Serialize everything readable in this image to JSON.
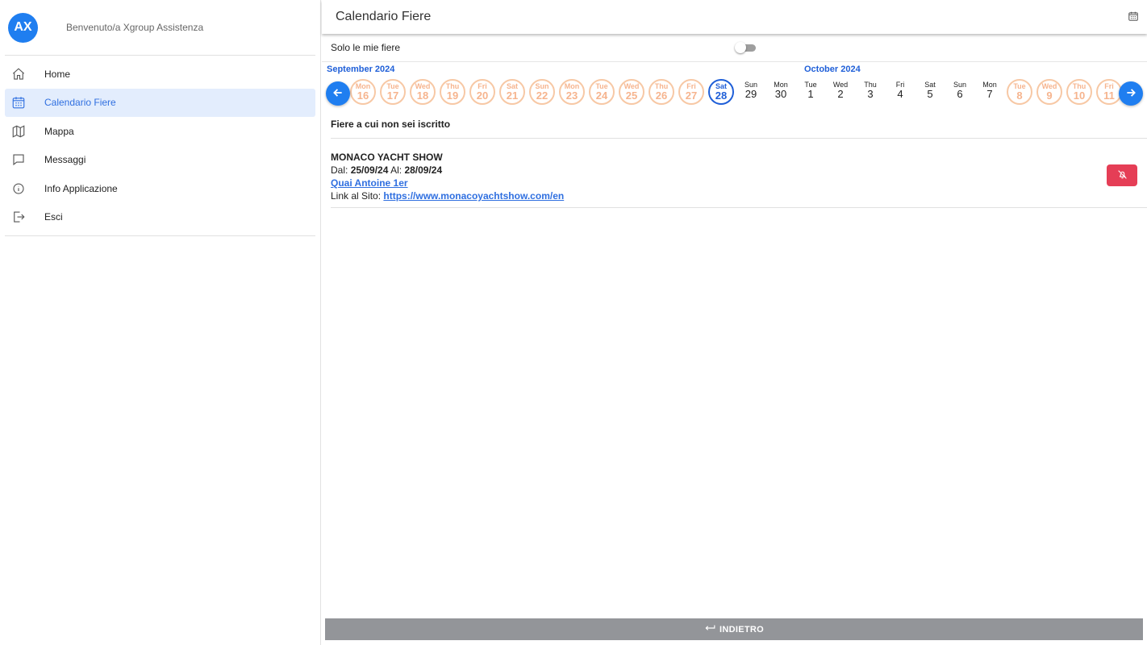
{
  "user": {
    "initials": "AX",
    "welcome": "Benvenuto/a Xgroup Assistenza"
  },
  "sidebar": {
    "items": [
      {
        "label": "Home",
        "icon": "home-icon",
        "active": false
      },
      {
        "label": "Calendario Fiere",
        "icon": "calendar-icon",
        "active": true
      },
      {
        "label": "Mappa",
        "icon": "map-icon",
        "active": false
      },
      {
        "label": "Messaggi",
        "icon": "message-icon",
        "active": false
      },
      {
        "label": "Info Applicazione",
        "icon": "info-icon",
        "active": false
      },
      {
        "label": "Esci",
        "icon": "logout-icon",
        "active": false
      }
    ]
  },
  "header": {
    "title": "Calendario Fiere",
    "icon": "calendar-icon"
  },
  "filter": {
    "label": "Solo le mie fiere",
    "toggle_on": false
  },
  "calendar": {
    "months": [
      "September 2024",
      "October 2024"
    ],
    "days": [
      {
        "name": "Mon",
        "num": "16",
        "state": "past"
      },
      {
        "name": "Tue",
        "num": "17",
        "state": "past"
      },
      {
        "name": "Wed",
        "num": "18",
        "state": "past"
      },
      {
        "name": "Thu",
        "num": "19",
        "state": "past"
      },
      {
        "name": "Fri",
        "num": "20",
        "state": "past"
      },
      {
        "name": "Sat",
        "num": "21",
        "state": "past"
      },
      {
        "name": "Sun",
        "num": "22",
        "state": "past"
      },
      {
        "name": "Mon",
        "num": "23",
        "state": "past"
      },
      {
        "name": "Tue",
        "num": "24",
        "state": "past"
      },
      {
        "name": "Wed",
        "num": "25",
        "state": "past"
      },
      {
        "name": "Thu",
        "num": "26",
        "state": "past"
      },
      {
        "name": "Fri",
        "num": "27",
        "state": "past"
      },
      {
        "name": "Sat",
        "num": "28",
        "state": "today"
      },
      {
        "name": "Sun",
        "num": "29",
        "state": "normal"
      },
      {
        "name": "Mon",
        "num": "30",
        "state": "normal"
      },
      {
        "name": "Tue",
        "num": "1",
        "state": "normal"
      },
      {
        "name": "Wed",
        "num": "2",
        "state": "normal"
      },
      {
        "name": "Thu",
        "num": "3",
        "state": "normal"
      },
      {
        "name": "Fri",
        "num": "4",
        "state": "normal"
      },
      {
        "name": "Sat",
        "num": "5",
        "state": "normal"
      },
      {
        "name": "Sun",
        "num": "6",
        "state": "normal"
      },
      {
        "name": "Mon",
        "num": "7",
        "state": "normal"
      },
      {
        "name": "Tue",
        "num": "8",
        "state": "future"
      },
      {
        "name": "Wed",
        "num": "9",
        "state": "future"
      },
      {
        "name": "Thu",
        "num": "10",
        "state": "future"
      },
      {
        "name": "Fri",
        "num": "11",
        "state": "future"
      }
    ]
  },
  "section": {
    "title": "Fiere a cui non sei iscritto"
  },
  "event": {
    "title": "MONACO YACHT SHOW",
    "from_label": "Dal:",
    "from_date": "25/09/24",
    "to_label": "Al:",
    "to_date": "28/09/24",
    "location": "Quai Antoine 1er",
    "site_label": "Link al Sito:",
    "site_url": "https://www.monacoyachtshow.com/en",
    "mute_icon": "bell-off-icon"
  },
  "footer": {
    "back_label": "INDIETRO"
  },
  "colors": {
    "accent": "#1f7ef0",
    "danger": "#e53e56",
    "past_day": "#f6b48e",
    "active_nav_bg": "#e3edfd"
  }
}
